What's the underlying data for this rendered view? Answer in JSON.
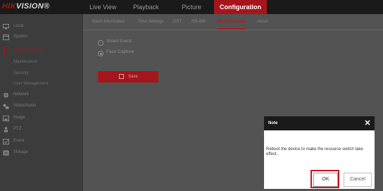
{
  "app": {
    "logo_hik": "HIK",
    "logo_vision": "VISION®"
  },
  "nav": {
    "items": [
      "Live View",
      "Playback",
      "Picture",
      "Configuration"
    ],
    "active": "Configuration"
  },
  "sidebar": {
    "local": "Local",
    "system": "System",
    "system_sub": [
      "System Settings",
      "Maintenance",
      "Security",
      "User Management"
    ],
    "active_sub": "System Settings",
    "network": "Network",
    "video_audio": "Video/Audio",
    "image": "Image",
    "ptz": "PTZ",
    "event": "Event",
    "storage": "Storage"
  },
  "tabs": [
    "Basic Information",
    "Time Settings",
    "DST",
    "RS-485",
    "VCA Resource",
    "About"
  ],
  "active_tab": "VCA Resource",
  "vca": {
    "options": [
      "Smart Event",
      "Face Capture"
    ],
    "selected": "Face Capture",
    "save_label": "Save"
  },
  "dialog": {
    "title": "Note",
    "close_symbol": "✕",
    "message": "Reboot the device to make the resource switch take effect.",
    "ok_label": "OK",
    "cancel_label": "Cancel"
  },
  "colors": {
    "accent": "#a6151b",
    "topbar": "#1a1a1a",
    "sidebar": "#3c3c3c",
    "main": "#535353"
  }
}
